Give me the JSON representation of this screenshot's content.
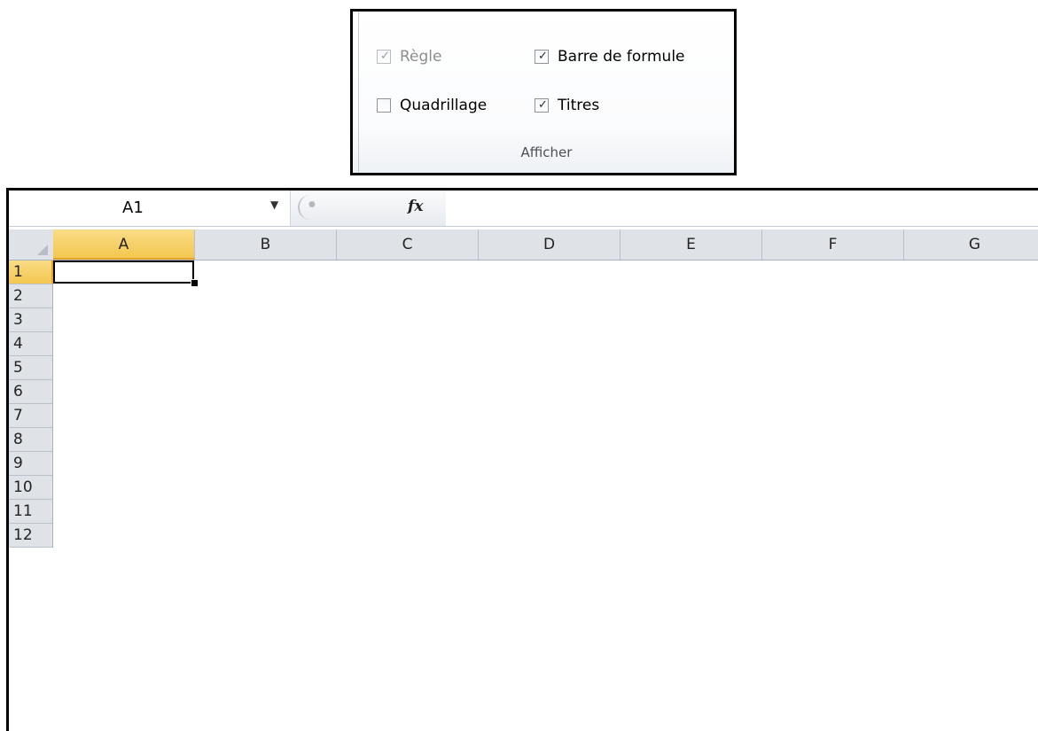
{
  "ribbon": {
    "options": [
      {
        "label": "Règle",
        "checked": true,
        "disabled": true
      },
      {
        "label": "Barre de formule",
        "checked": true,
        "disabled": false
      },
      {
        "label": "Quadrillage",
        "checked": false,
        "disabled": false
      },
      {
        "label": "Titres",
        "checked": true,
        "disabled": false
      }
    ],
    "group_label": "Afficher"
  },
  "formula_bar": {
    "name_box": "A1",
    "name_box_arrow_icon": "dropdown-arrow-icon",
    "fx_label": "fx",
    "formula": ""
  },
  "sheet": {
    "columns": [
      "A",
      "B",
      "C",
      "D",
      "E",
      "F",
      "G"
    ],
    "rows": [
      "1",
      "2",
      "3",
      "4",
      "5",
      "6",
      "7",
      "8",
      "9",
      "10",
      "11",
      "12"
    ],
    "active_cell": "A1",
    "selected_header_color": "#f5cb5c"
  }
}
